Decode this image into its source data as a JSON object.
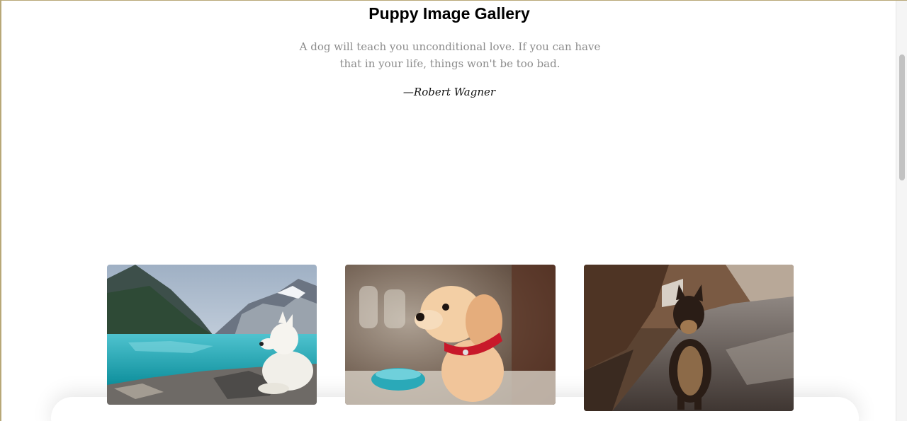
{
  "page": {
    "title": "Puppy Image Gallery",
    "quote": "A dog will teach you unconditional love. If you can have that in your life, things won't be too bad.",
    "author": "—Robert Wagner"
  },
  "gallery": {
    "images": [
      {
        "name": "samoyed-by-lake-image"
      },
      {
        "name": "golden-puppy-red-collar-image"
      },
      {
        "name": "german-shepherd-on-road-image"
      }
    ]
  },
  "colors": {
    "quote_text": "#8c8c8c",
    "title_text": "#000000",
    "frame_border": "#b8a878"
  }
}
